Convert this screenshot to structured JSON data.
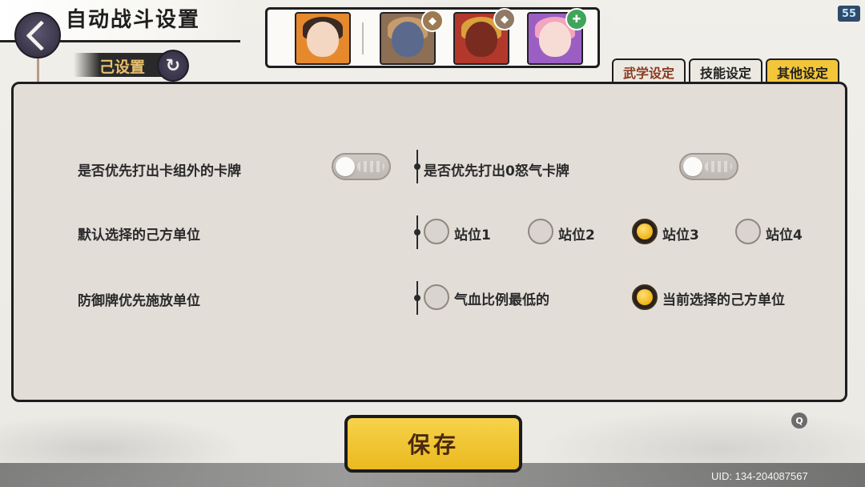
{
  "header": {
    "title": "自动战斗设置",
    "sub_label": "己设置",
    "fps": "55"
  },
  "team": {
    "heroes": [
      {
        "name": "hero-1",
        "bg": "#e6892d"
      },
      {
        "name": "hero-2",
        "bg": "#8d6f55",
        "badge_color": "#9c7a52"
      },
      {
        "name": "hero-3",
        "bg": "#b3382c",
        "badge_color": "#8f7a66"
      },
      {
        "name": "hero-4",
        "bg": "#9b5fc4",
        "badge_color": "#3fa55a"
      }
    ]
  },
  "tabs": [
    {
      "label": "武学设定",
      "active": false
    },
    {
      "label": "技能设定",
      "active": false
    },
    {
      "label": "其他设定",
      "active": true
    }
  ],
  "settings": {
    "row1": {
      "left_label": "是否优先打出卡组外的卡牌",
      "left_toggle": false,
      "right_label": "是否优先打出0怒气卡牌",
      "right_toggle": false
    },
    "row2": {
      "label": "默认选择的己方单位",
      "options": [
        "站位1",
        "站位2",
        "站位3",
        "站位4"
      ],
      "selected": "站位3"
    },
    "row3": {
      "label": "防御牌优先施放单位",
      "options": [
        "气血比例最低的",
        "当前选择的己方单位"
      ],
      "selected": "当前选择的己方单位"
    }
  },
  "footer": {
    "save_label": "保存",
    "uid": "UID: 134-204087567",
    "help_icon_text": "Q"
  },
  "colors": {
    "accent": "#f3c63a",
    "panel": "#e3ddd8",
    "dark": "#1e1e1e"
  }
}
